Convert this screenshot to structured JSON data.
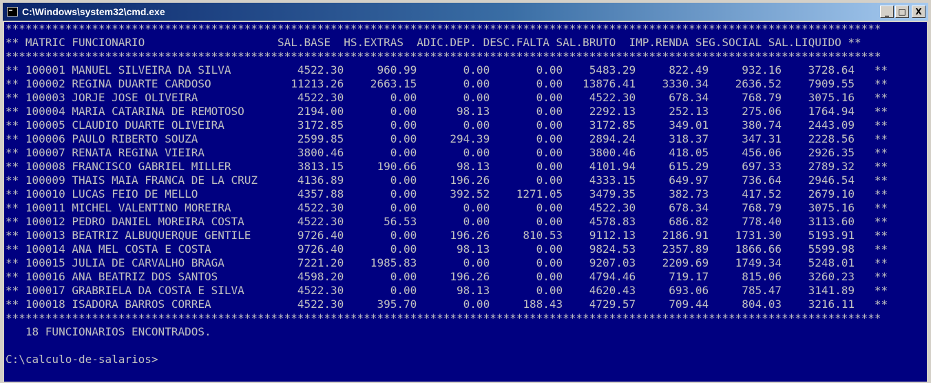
{
  "window": {
    "title": "C:\\Windows\\system32\\cmd.exe",
    "minimize_label": "_",
    "maximize_label": "□",
    "close_label": "X"
  },
  "console": {
    "star_line": "************************************************************************************************************************************",
    "columns": [
      "MATRIC",
      "FUNCIONARIO",
      "SAL.BASE",
      "HS.EXTRAS",
      "ADIC.DEP.",
      "DESC.FALTA",
      "SAL.BRUTO",
      "IMP.RENDA",
      "SEG.SOCIAL",
      "SAL.LIQUIDO"
    ],
    "rows": [
      [
        "100001",
        "MANUEL SILVEIRA DA SILVA",
        "4522.30",
        "960.99",
        "0.00",
        "0.00",
        "5483.29",
        "822.49",
        "932.16",
        "3728.64"
      ],
      [
        "100002",
        "REGINA DUARTE CARDOSO",
        "11213.26",
        "2663.15",
        "0.00",
        "0.00",
        "13876.41",
        "3330.34",
        "2636.52",
        "7909.55"
      ],
      [
        "100003",
        "JORJE JOSE OLIVEIRA",
        "4522.30",
        "0.00",
        "0.00",
        "0.00",
        "4522.30",
        "678.34",
        "768.79",
        "3075.16"
      ],
      [
        "100004",
        "MARIA CATARINA DE REMOTOSO",
        "2194.00",
        "0.00",
        "98.13",
        "0.00",
        "2292.13",
        "252.13",
        "275.06",
        "1764.94"
      ],
      [
        "100005",
        "CLAUDIO DUARTE OLIVEIRA",
        "3172.85",
        "0.00",
        "0.00",
        "0.00",
        "3172.85",
        "349.01",
        "380.74",
        "2443.09"
      ],
      [
        "100006",
        "PAULO RIBERTO SOUZA",
        "2599.85",
        "0.00",
        "294.39",
        "0.00",
        "2894.24",
        "318.37",
        "347.31",
        "2228.56"
      ],
      [
        "100007",
        "RENATA REGINA VIEIRA",
        "3800.46",
        "0.00",
        "0.00",
        "0.00",
        "3800.46",
        "418.05",
        "456.06",
        "2926.35"
      ],
      [
        "100008",
        "FRANCISCO GABRIEL MILLER",
        "3813.15",
        "190.66",
        "98.13",
        "0.00",
        "4101.94",
        "615.29",
        "697.33",
        "2789.32"
      ],
      [
        "100009",
        "THAIS MAIA FRANCA DE LA CRUZ",
        "4136.89",
        "0.00",
        "196.26",
        "0.00",
        "4333.15",
        "649.97",
        "736.64",
        "2946.54"
      ],
      [
        "100010",
        "LUCAS FEIO DE MELLO",
        "4357.88",
        "0.00",
        "392.52",
        "1271.05",
        "3479.35",
        "382.73",
        "417.52",
        "2679.10"
      ],
      [
        "100011",
        "MICHEL VALENTINO MOREIRA",
        "4522.30",
        "0.00",
        "0.00",
        "0.00",
        "4522.30",
        "678.34",
        "768.79",
        "3075.16"
      ],
      [
        "100012",
        "PEDRO DANIEL MOREIRA COSTA",
        "4522.30",
        "56.53",
        "0.00",
        "0.00",
        "4578.83",
        "686.82",
        "778.40",
        "3113.60"
      ],
      [
        "100013",
        "BEATRIZ ALBUQUERQUE GENTILE",
        "9726.40",
        "0.00",
        "196.26",
        "810.53",
        "9112.13",
        "2186.91",
        "1731.30",
        "5193.91"
      ],
      [
        "100014",
        "ANA MEL COSTA E COSTA",
        "9726.40",
        "0.00",
        "98.13",
        "0.00",
        "9824.53",
        "2357.89",
        "1866.66",
        "5599.98"
      ],
      [
        "100015",
        "JULIA DE CARVALHO BRAGA",
        "7221.20",
        "1985.83",
        "0.00",
        "0.00",
        "9207.03",
        "2209.69",
        "1749.34",
        "5248.01"
      ],
      [
        "100016",
        "ANA BEATRIZ DOS SANTOS",
        "4598.20",
        "0.00",
        "196.26",
        "0.00",
        "4794.46",
        "719.17",
        "815.06",
        "3260.23"
      ],
      [
        "100017",
        "GRABRIELA DA COSTA E SILVA",
        "4522.30",
        "0.00",
        "98.13",
        "0.00",
        "4620.43",
        "693.06",
        "785.47",
        "3141.89"
      ],
      [
        "100018",
        "ISADORA BARROS CORREA",
        "4522.30",
        "395.70",
        "0.00",
        "188.43",
        "4729.57",
        "709.44",
        "804.03",
        "3216.11"
      ]
    ],
    "summary": "18 FUNCIONARIOS ENCONTRADOS.",
    "prompt": "C:\\calculo-de-salarios>"
  },
  "colors": {
    "console_bg": "#000080",
    "console_fg": "#c0c0c0",
    "title_start": "#0a246a",
    "title_end": "#a6caf0"
  }
}
